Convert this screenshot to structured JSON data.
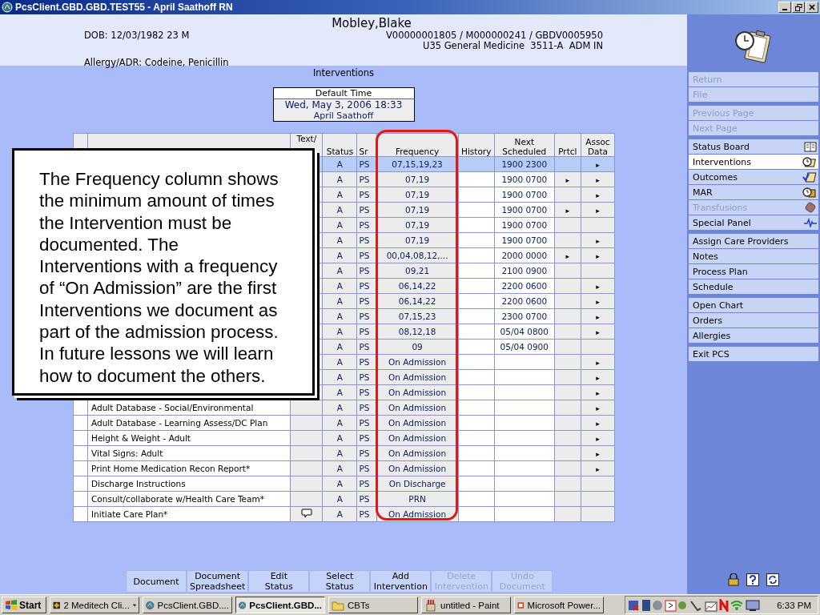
{
  "window": {
    "title": "PcsClient.GBD.GBD.TEST55 - April Saathoff RN"
  },
  "patient": {
    "name": "Mobley,Blake",
    "dob": "DOB: 12/03/1982 23 M",
    "ids": "V00000001805 / M000000241 / GBDV0005950",
    "location": "U35 General Medicine  3511-A  ADM IN",
    "allergy": "Allergy/ADR: Codeine, Penicillin"
  },
  "page_title": "Interventions",
  "default_time": {
    "label": "Default Time",
    "datetime": "Wed, May 3, 2006  18:33",
    "user": "April Saathoff"
  },
  "table": {
    "columns": {
      "text_code": "Text/",
      "status": "Status",
      "src": "Sr",
      "frequency": "Frequency",
      "history": "History",
      "next": "Next\nScheduled",
      "prtcl": "Prtcl",
      "assoc": "Assoc\nData"
    },
    "rows": [
      {
        "selected": true,
        "note": false,
        "status": "A",
        "src": "PS",
        "frequency": "07,15,19,23",
        "next": "1900 2300",
        "assoc": "▸"
      },
      {
        "selected": false,
        "note": false,
        "status": "A",
        "src": "PS",
        "frequency": "07,19",
        "next": "1900 0700",
        "prtcl": "▸",
        "assoc": "▸"
      },
      {
        "selected": false,
        "note": false,
        "status": "A",
        "src": "PS",
        "frequency": "07,19",
        "next": "1900 0700",
        "assoc": "▸"
      },
      {
        "selected": false,
        "note": false,
        "status": "A",
        "src": "PS",
        "frequency": "07,19",
        "next": "1900 0700",
        "prtcl": "▸",
        "assoc": "▸"
      },
      {
        "selected": false,
        "note": false,
        "status": "A",
        "src": "PS",
        "frequency": "07,19",
        "next": "1900 0700"
      },
      {
        "selected": false,
        "note": false,
        "status": "A",
        "src": "PS",
        "frequency": "07,19",
        "next": "1900 0700",
        "assoc": "▸"
      },
      {
        "selected": false,
        "note": false,
        "status": "A",
        "src": "PS",
        "frequency": "00,04,08,12,...",
        "next": "2000 0000",
        "prtcl": "▸",
        "assoc": "▸"
      },
      {
        "selected": false,
        "note": false,
        "status": "A",
        "src": "PS",
        "frequency": "09,21",
        "next": "2100 0900"
      },
      {
        "selected": false,
        "note": false,
        "status": "A",
        "src": "PS",
        "frequency": "06,14,22",
        "next": "2200 0600",
        "assoc": "▸"
      },
      {
        "selected": false,
        "note": false,
        "status": "A",
        "src": "PS",
        "frequency": "06,14,22",
        "next": "2200 0600",
        "assoc": "▸"
      },
      {
        "selected": false,
        "note": false,
        "status": "A",
        "src": "PS",
        "frequency": "07,15,23",
        "next": "2300 0700",
        "assoc": "▸"
      },
      {
        "selected": false,
        "note": false,
        "status": "A",
        "src": "PS",
        "frequency": "08,12,18",
        "next": "05/04 0800",
        "assoc": "▸"
      },
      {
        "selected": false,
        "note": false,
        "status": "A",
        "src": "PS",
        "frequency": "09",
        "next": "05/04 0900"
      },
      {
        "selected": false,
        "note": false,
        "status": "A",
        "src": "PS",
        "frequency": "On Admission",
        "assoc": "▸"
      },
      {
        "selected": false,
        "note": false,
        "status": "A",
        "src": "PS",
        "frequency": "On Admission",
        "assoc": "▸"
      },
      {
        "selected": false,
        "note": false,
        "status": "A",
        "src": "PS",
        "frequency": "On Admission",
        "assoc": "▸"
      },
      {
        "selected": false,
        "note": false,
        "name": "Adult Database - Social/Environmental",
        "status": "A",
        "src": "PS",
        "frequency": "On Admission",
        "assoc": "▸"
      },
      {
        "selected": false,
        "note": false,
        "name": "Adult Database - Learning Assess/DC Plan",
        "status": "A",
        "src": "PS",
        "frequency": "On Admission",
        "assoc": "▸"
      },
      {
        "selected": false,
        "note": false,
        "name": "Height & Weight - Adult",
        "status": "A",
        "src": "PS",
        "frequency": "On Admission",
        "assoc": "▸"
      },
      {
        "selected": false,
        "note": false,
        "name": "Vital Signs: Adult",
        "status": "A",
        "src": "PS",
        "frequency": "On Admission",
        "assoc": "▸"
      },
      {
        "selected": false,
        "note": false,
        "name": "Print Home Medication Recon Report*",
        "status": "A",
        "src": "PS",
        "frequency": "On Admission",
        "assoc": "▸"
      },
      {
        "selected": false,
        "note": false,
        "name": "Discharge Instructions",
        "status": "A",
        "src": "PS",
        "frequency": "On Discharge"
      },
      {
        "selected": false,
        "note": false,
        "name": "Consult/collaborate w/Health Care Team*",
        "status": "A",
        "src": "PS",
        "frequency": "PRN"
      },
      {
        "selected": false,
        "note": true,
        "name": "Initiate Care Plan*",
        "status": "A",
        "src": "PS",
        "frequency": "On Admission"
      }
    ]
  },
  "callout": {
    "text": "The Frequency column shows the minimum amount of times the Intervention must be documented. The Interventions with a frequency of “On Admission” are the first Interventions we document as part of the admission process. In future lessons we will learn how to document the others."
  },
  "toolbar": [
    {
      "label": "Document",
      "disabled": false
    },
    {
      "label": "Document\nSpreadsheet",
      "disabled": false
    },
    {
      "label": "Edit\nStatus",
      "disabled": false
    },
    {
      "label": "Select\nStatus",
      "disabled": false
    },
    {
      "label": "Add\nIntervention",
      "disabled": false
    },
    {
      "label": "Delete\nIntervention",
      "disabled": true
    },
    {
      "label": "Undo\nDocument",
      "disabled": true
    }
  ],
  "sidebar": {
    "groups": [
      [
        {
          "label": "Return",
          "disabled": true,
          "selected": false
        },
        {
          "label": "File",
          "disabled": true,
          "selected": false
        }
      ],
      [
        {
          "label": "Previous Page",
          "disabled": true,
          "selected": false
        },
        {
          "label": "Next Page",
          "disabled": true,
          "selected": false
        }
      ],
      [
        {
          "label": "Status Board",
          "disabled": false,
          "selected": false,
          "kind": "board"
        },
        {
          "label": "Interventions",
          "disabled": false,
          "selected": true,
          "kind": "clock-note"
        },
        {
          "label": "Outcomes",
          "disabled": false,
          "selected": false,
          "kind": "check-note"
        },
        {
          "label": "MAR",
          "disabled": false,
          "selected": false,
          "kind": "clock-box"
        },
        {
          "label": "Transfusions",
          "disabled": true,
          "selected": false,
          "kind": "bag"
        },
        {
          "label": "Special Panel",
          "disabled": false,
          "selected": false,
          "kind": "pulse"
        }
      ],
      [
        {
          "label": "Assign Care Providers",
          "disabled": false,
          "selected": false
        },
        {
          "label": "Notes",
          "disabled": false,
          "selected": false
        },
        {
          "label": "Process Plan",
          "disabled": false,
          "selected": false
        },
        {
          "label": "Schedule",
          "disabled": false,
          "selected": false
        }
      ],
      [
        {
          "label": "Open Chart",
          "disabled": false,
          "selected": false
        },
        {
          "label": "Orders",
          "disabled": false,
          "selected": false
        },
        {
          "label": "Allergies",
          "disabled": false,
          "selected": false
        }
      ],
      [
        {
          "label": "Exit PCS",
          "disabled": false,
          "selected": false
        }
      ]
    ]
  },
  "taskbar": {
    "start": "Start",
    "tasks": [
      {
        "label": "2 Meditech Cli...",
        "selected": false,
        "kind": "meditech"
      },
      {
        "label": "PcsClient.GBD....",
        "selected": false,
        "kind": "pcs"
      },
      {
        "label": "PcsClient.GBD...",
        "selected": true,
        "kind": "pcs"
      },
      {
        "label": "CBTs",
        "selected": false,
        "kind": "folder"
      },
      {
        "label": "untitled - Paint",
        "selected": false,
        "kind": "paint"
      },
      {
        "label": "Microsoft Power...",
        "selected": false,
        "kind": "ppt"
      }
    ],
    "clock": "6:33 PM"
  }
}
